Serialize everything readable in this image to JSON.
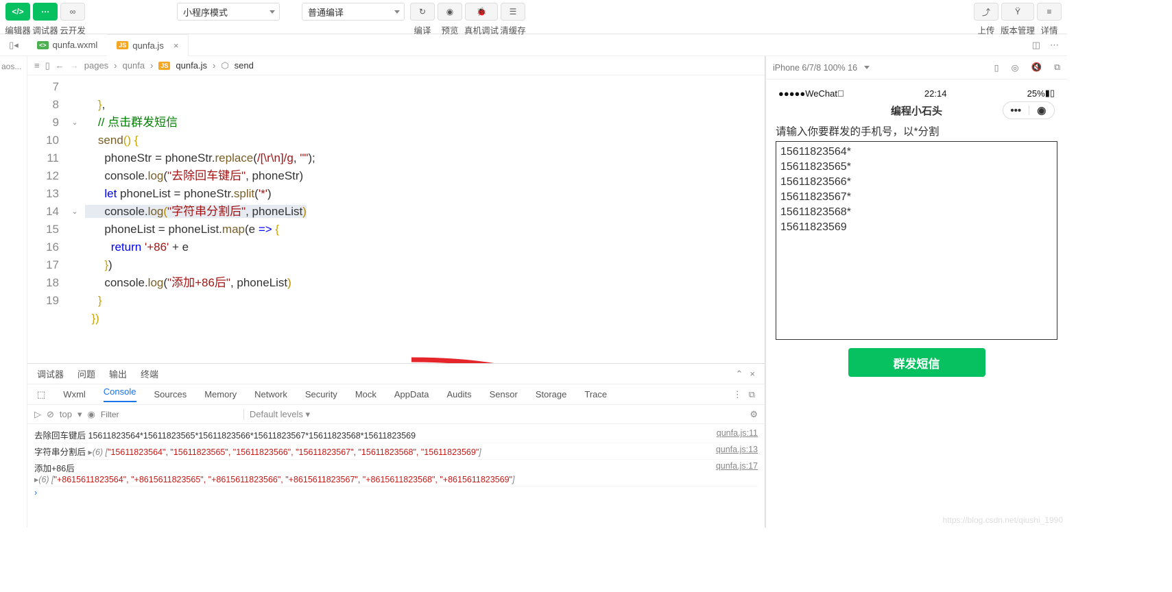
{
  "toolbar": {
    "editor_label": "编辑器",
    "debugger_label": "调试器",
    "cloud_label": "云开发",
    "mode_select": "小程序模式",
    "compile_select": "普通编译",
    "compile_label": "编译",
    "preview_label": "预览",
    "remote_debug_label": "真机调试",
    "clear_cache_label": "清缓存",
    "upload_label": "上传",
    "version_label": "版本管理",
    "details_label": "详情"
  },
  "tabs": {
    "file1": "qunfa.wxml",
    "file2": "qunfa.js"
  },
  "sidebar_stub": "aos...",
  "breadcrumb": [
    "pages",
    "qunfa",
    "qunfa.js",
    "send"
  ],
  "code": {
    "lines": [
      7,
      8,
      9,
      10,
      11,
      12,
      13,
      14,
      15,
      16,
      17,
      18,
      19
    ],
    "l7": "},",
    "l8_cmt": "// 点击群发短信",
    "l9a": "send",
    "l9b": "() {",
    "l10": "phoneStr = phoneStr.replace(/[\\r\\n]/g, \"\");",
    "l11a": "console.",
    "l11b": "log",
    "l11c": "(\"去除回车键后\", phoneStr)",
    "l12": "let phoneList = phoneStr.split('*')",
    "l13a": "console.",
    "l13b": "log",
    "l13c": "(\"字符串分割后\", phoneList)",
    "l14": "phoneList = phoneList.map(e => {",
    "l15a": "return ",
    "l15b": "'+86'",
    "l15c": " + e",
    "l16": "})",
    "l17a": "console.",
    "l17b": "log",
    "l17c": "(\"添加+86后\", phoneList)",
    "l18": "}",
    "l19": "})"
  },
  "panel_tabs": {
    "debugger": "调试器",
    "problems": "问题",
    "output": "输出",
    "terminal": "终端"
  },
  "devtool_tabs": [
    "Wxml",
    "Console",
    "Sources",
    "Memory",
    "Network",
    "Security",
    "Mock",
    "AppData",
    "Audits",
    "Sensor",
    "Storage",
    "Trace"
  ],
  "filter": {
    "top": "top",
    "placeholder": "Filter",
    "levels": "Default levels"
  },
  "console": {
    "row1_label": "去除回车键后",
    "row1_value": "15611823564*15611823565*15611823566*15611823567*15611823568*15611823569",
    "row1_src": "qunfa.js:11",
    "row2_label": "字符串分割后",
    "row2_count": "(6)",
    "row2_arr": [
      "\"15611823564\"",
      "\"15611823565\"",
      "\"15611823566\"",
      "\"15611823567\"",
      "\"15611823568\"",
      "\"15611823569\""
    ],
    "row2_src": "qunfa.js:13",
    "row3_label": "添加+86后",
    "row3_count": "(6)",
    "row3_arr": [
      "\"+8615611823564\"",
      "\"+8615611823565\"",
      "\"+8615611823566\"",
      "\"+8615611823567\"",
      "\"+8615611823568\"",
      "\"+8615611823569\""
    ],
    "row3_src": "qunfa.js:17"
  },
  "simbar": {
    "device": "iPhone 6/7/8 100% 16"
  },
  "phone": {
    "carrier": "WeChat",
    "time": "22:14",
    "battery": "25%",
    "title": "编程小石头",
    "hint": "请输入你要群发的手机号，以*分割",
    "textarea": "15611823564*\n15611823565*\n15611823566*\n15611823567*\n15611823568*\n15611823569",
    "button": "群发短信"
  },
  "watermark": "https://blog.csdn.net/qiushi_1990"
}
